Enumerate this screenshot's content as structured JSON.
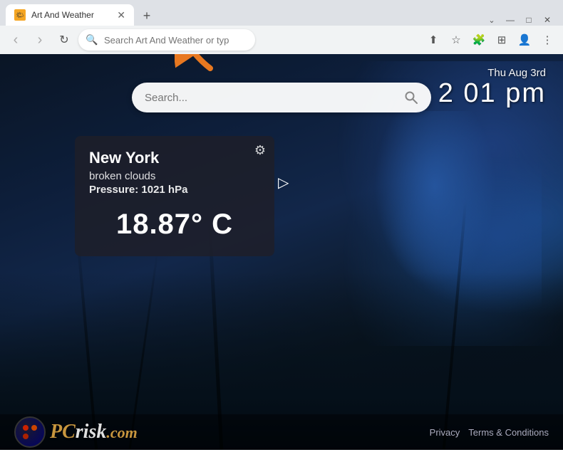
{
  "browser": {
    "tab_title": "Art And Weather",
    "new_tab_label": "+",
    "address_placeholder": "Search Art And Weather or type a URL",
    "address_value": "Search Art And Weather or type a URL"
  },
  "nav_buttons": {
    "back": "‹",
    "forward": "›",
    "refresh": "↻"
  },
  "window_controls": {
    "minimize": "—",
    "maximize": "□",
    "close": "✕"
  },
  "page": {
    "search_placeholder": "Search...",
    "datetime": {
      "date": "Thu Aug 3rd",
      "time": "2 01 pm"
    },
    "weather": {
      "city": "New York",
      "condition": "broken clouds",
      "pressure_label": "Pressure:",
      "pressure_value": "1021 hPa",
      "temperature": "18.87° C",
      "gear_icon": "⚙"
    },
    "footer": {
      "logo_text_colored": "PC",
      "logo_text_dark": "risk",
      "logo_suffix": ".com",
      "privacy_link": "Privacy",
      "terms_link": "Terms & Conditions"
    }
  }
}
